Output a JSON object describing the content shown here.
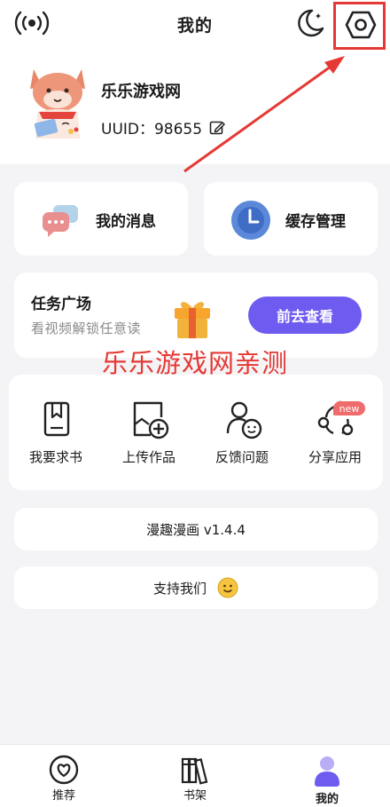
{
  "header": {
    "title": "我的",
    "icons": [
      "broadcast-icon",
      "moon-icon",
      "settings-hexagon-icon"
    ]
  },
  "profile": {
    "username": "乐乐游戏网",
    "uuid_label": "UUID：98655"
  },
  "quick_actions": [
    {
      "label": "我的消息",
      "icon": "chat-bubbles-icon"
    },
    {
      "label": "缓存管理",
      "icon": "clock-icon"
    }
  ],
  "task": {
    "title": "任务广场",
    "subtitle": "看视频解锁任意读",
    "button": "前去查看"
  },
  "watermark": "乐乐游戏网亲测",
  "tools": [
    {
      "label": "我要求书",
      "icon": "book-request-icon"
    },
    {
      "label": "上传作品",
      "icon": "upload-work-icon"
    },
    {
      "label": "反馈问题",
      "icon": "feedback-icon"
    },
    {
      "label": "分享应用",
      "icon": "share-icon",
      "badge": "new"
    }
  ],
  "version_text": "漫趣漫画 v1.4.4",
  "support_text": "支持我们",
  "bottom_nav": [
    {
      "label": "推荐",
      "icon": "heart-circle-icon"
    },
    {
      "label": "书架",
      "icon": "bookshelf-icon"
    },
    {
      "label": "我的",
      "icon": "profile-icon",
      "active": true
    }
  ],
  "colors": {
    "accent": "#6e5bf0",
    "annotation_red": "#e53935",
    "badge": "#f06b6b"
  }
}
